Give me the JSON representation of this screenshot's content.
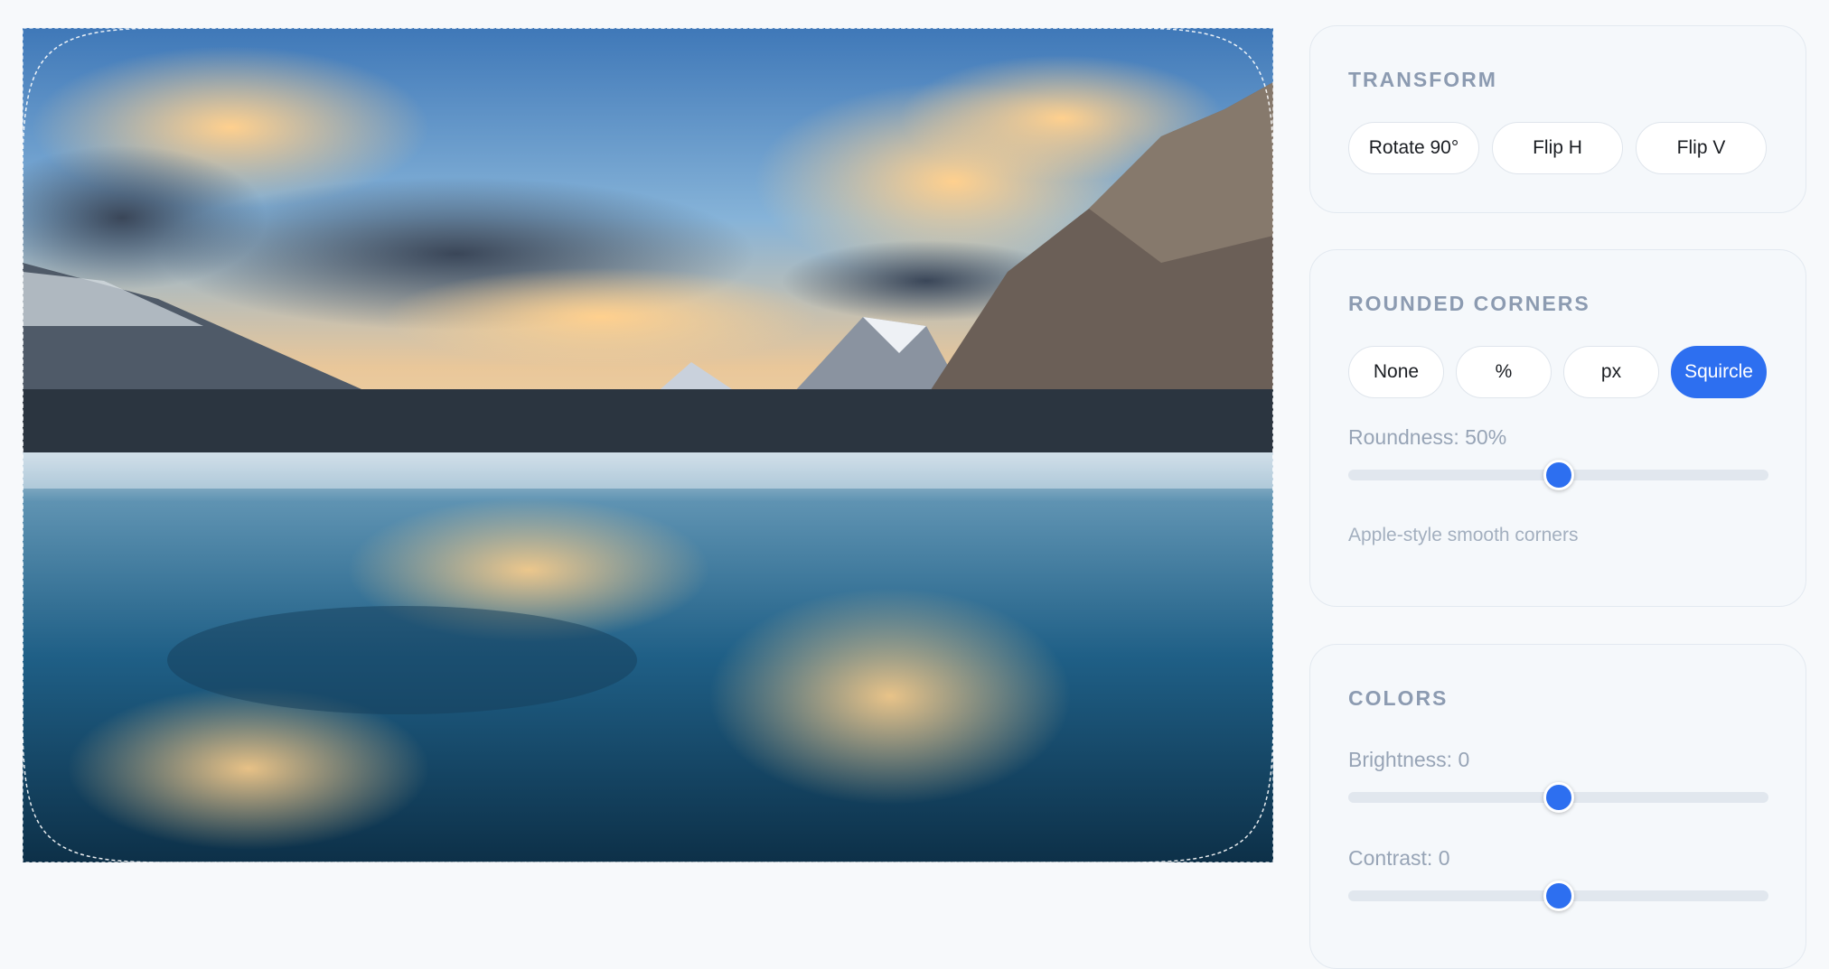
{
  "transform": {
    "title": "TRANSFORM",
    "buttons": [
      "Rotate 90°",
      "Flip H",
      "Flip V"
    ]
  },
  "rounded_corners": {
    "title": "ROUNDED CORNERS",
    "modes": [
      "None",
      "%",
      "px",
      "Squircle"
    ],
    "selected_mode": "Squircle",
    "roundness_label": "Roundness: 50%",
    "roundness_value": 50,
    "hint": "Apple-style smooth corners"
  },
  "colors": {
    "title": "COLORS",
    "brightness_label": "Brightness: 0",
    "brightness_value": 0,
    "contrast_label": "Contrast: 0",
    "contrast_value": 0
  },
  "theme": {
    "accent": "#2d6ff0",
    "panel_bg": "#f5f8fb",
    "muted_text": "#8c9bb1"
  }
}
